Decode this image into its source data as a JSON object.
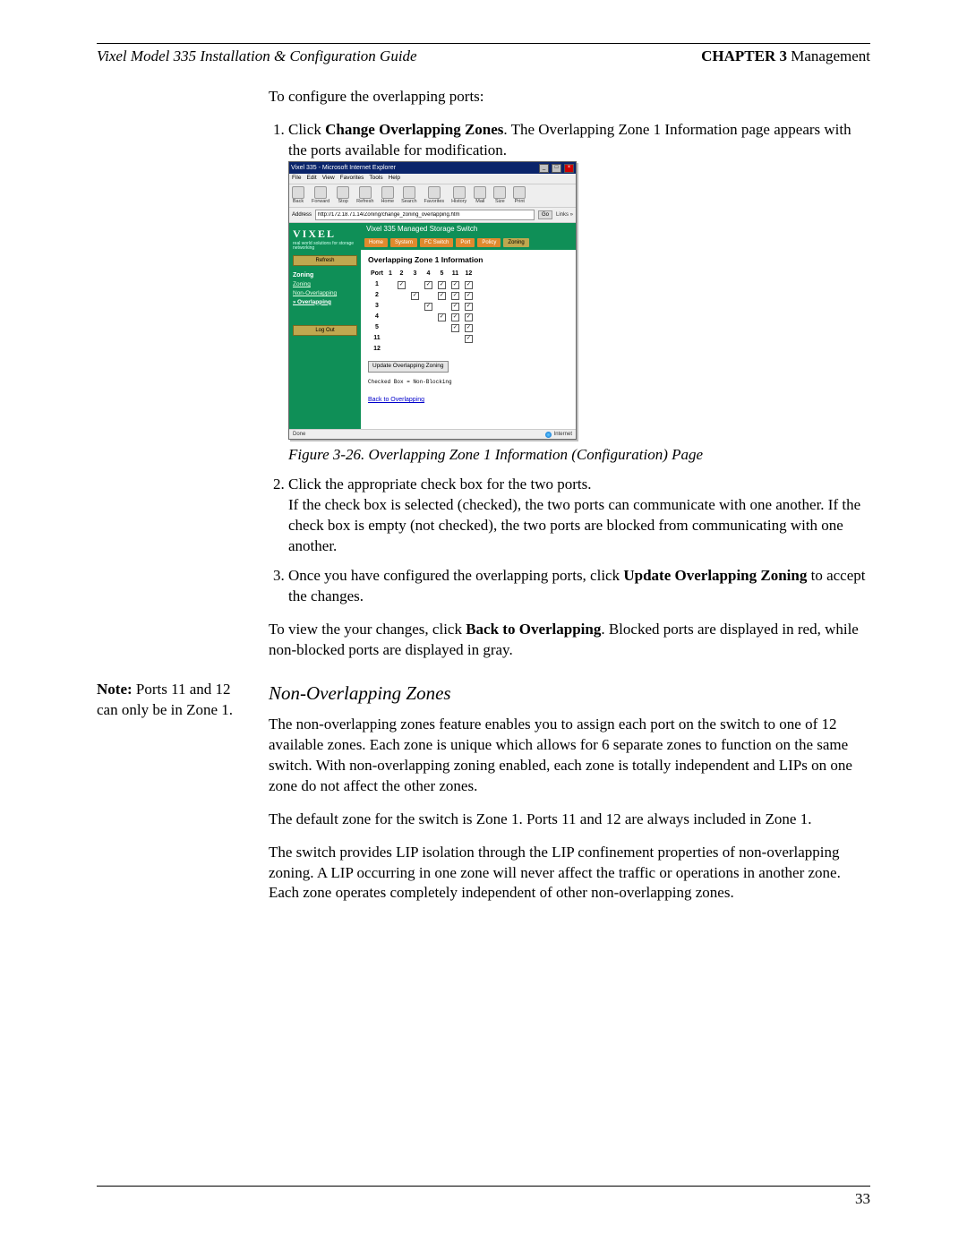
{
  "header": {
    "doc_title": "Vixel Model 335 Installation & Configuration Guide",
    "chapter_label": "CHAPTER 3",
    "chapter_name": " Management"
  },
  "intro_text": "To configure the overlapping ports:",
  "step1_prefix": "Click ",
  "step1_bold": "Change Overlapping Zones",
  "step1_suffix": ". The Overlapping Zone 1 Information page appears with the ports available for modification.",
  "figure_caption": "Figure 3-26. Overlapping Zone 1 Information (Configuration) Page",
  "step2_line1": "Click the appropriate check box for the two ports.",
  "step2_line2": "If the check box is selected (checked), the two ports can communicate with one another. If the check box is empty (not checked), the two ports are blocked from communicating with one another.",
  "step3_prefix": "Once you have configured the overlapping ports, click ",
  "step3_bold": "Update Overlapping Zoning",
  "step3_suffix": " to accept the changes.",
  "view_prefix": "To view the your changes, click ",
  "view_bold": "Back to Overlapping",
  "view_suffix": ". Blocked ports are displayed in red, while non-blocked ports are displayed in gray.",
  "section_title": "Non-Overlapping Zones",
  "margin_note_label": "Note:",
  "margin_note_text": " Ports 11 and 12 can only be in Zone 1.",
  "p_nonoverlap_1": "The non-overlapping zones feature enables you to assign each port on the switch to one of 12 available zones. Each zone is unique which allows for 6 separate zones to function on the same switch. With non-overlapping zoning enabled, each zone is totally independent and LIPs on one zone do not affect the other zones.",
  "p_nonoverlap_2": "The default zone for the switch is Zone 1. Ports 11 and 12 are always included in Zone 1.",
  "p_nonoverlap_3": "The switch provides LIP isolation through the LIP confinement properties of non-overlapping zoning. A LIP occurring in one zone will never affect the traffic or operations in another zone. Each zone operates completely independent of other non-overlapping zones.",
  "page_number": "33",
  "screenshot": {
    "window_title": "Vixel 335 - Microsoft Internet Explorer",
    "menus": [
      "File",
      "Edit",
      "View",
      "Favorites",
      "Tools",
      "Help"
    ],
    "toolbar_buttons": [
      "Back",
      "Forward",
      "Stop",
      "Refresh",
      "Home",
      "Search",
      "Favorites",
      "History",
      "Mail",
      "Size",
      "Print"
    ],
    "address_label": "Address",
    "address_value": "http://172.18.71.14/Zoning/change_zoning_overlapping.htm",
    "go_label": "Go",
    "links_label": "Links »",
    "brand": "VIXEL",
    "brand_tag": "real world solutions for storage networking",
    "product_banner": "Vixel 335 Managed Storage Switch",
    "sidebar": {
      "refresh": "Refresh",
      "group": "Zoning",
      "items": [
        "Zoning",
        "Non-Overlapping",
        "Overlapping"
      ],
      "logout": "Log Out"
    },
    "tabs": [
      "Home",
      "System",
      "FC Switch",
      "Port",
      "Policy",
      "Zoning"
    ],
    "page_heading": "Overlapping Zone 1 Information",
    "table": {
      "col_headers": [
        "Port",
        "1",
        "2",
        "3",
        "4",
        "5",
        "11",
        "12"
      ],
      "rows": [
        {
          "label": "1",
          "cells": [
            "",
            "✓",
            "",
            "✓",
            "✓",
            "✓",
            "✓"
          ]
        },
        {
          "label": "2",
          "cells": [
            "",
            "",
            "✓",
            "",
            "✓",
            "✓",
            "✓"
          ]
        },
        {
          "label": "3",
          "cells": [
            "",
            "",
            "",
            "✓",
            "",
            "✓",
            "✓"
          ]
        },
        {
          "label": "4",
          "cells": [
            "",
            "",
            "",
            "",
            "✓",
            "✓",
            "✓"
          ]
        },
        {
          "label": "5",
          "cells": [
            "",
            "",
            "",
            "",
            "",
            "✓",
            "✓"
          ]
        },
        {
          "label": "11",
          "cells": [
            "",
            "",
            "",
            "",
            "",
            "",
            "✓"
          ]
        },
        {
          "label": "12",
          "cells": [
            "",
            "",
            "",
            "",
            "",
            "",
            ""
          ]
        }
      ]
    },
    "update_button": "Update Overlapping Zoning",
    "legend": "Checked Box = Non-Blocking",
    "back_link": "Back to Overlapping",
    "status_done": "Done",
    "status_zone": "Internet"
  }
}
